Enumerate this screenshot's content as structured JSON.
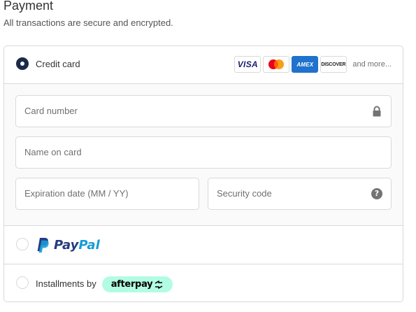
{
  "header": {
    "title": "Payment",
    "subtitle": "All transactions are secure and encrypted."
  },
  "credit_card": {
    "label": "Credit card",
    "selected": true,
    "logos": {
      "visa": "VISA",
      "mastercard": "mastercard",
      "amex": "AMEX",
      "discover": "DISCOVER"
    },
    "more_text": "and more...",
    "fields": {
      "card_number": "Card number",
      "name_on_card": "Name on card",
      "expiration": "Expiration date (MM / YY)",
      "security_code": "Security code"
    }
  },
  "paypal": {
    "selected": false,
    "brand_pay": "Pay",
    "brand_pal": "Pal"
  },
  "afterpay": {
    "selected": false,
    "label": "Installments by",
    "brand": "afterpay"
  },
  "colors": {
    "radio_selected": "#1c2a4a",
    "paypal_dark": "#253b80",
    "paypal_light": "#179bd7",
    "afterpay_mint": "#b2fce4",
    "border": "#d9d9d9"
  },
  "icons": {
    "card_number": "lock-icon",
    "security_code": "question-mark-icon",
    "paypal": "paypal-p-icon",
    "afterpay": "afterpay-arrows-icon"
  }
}
